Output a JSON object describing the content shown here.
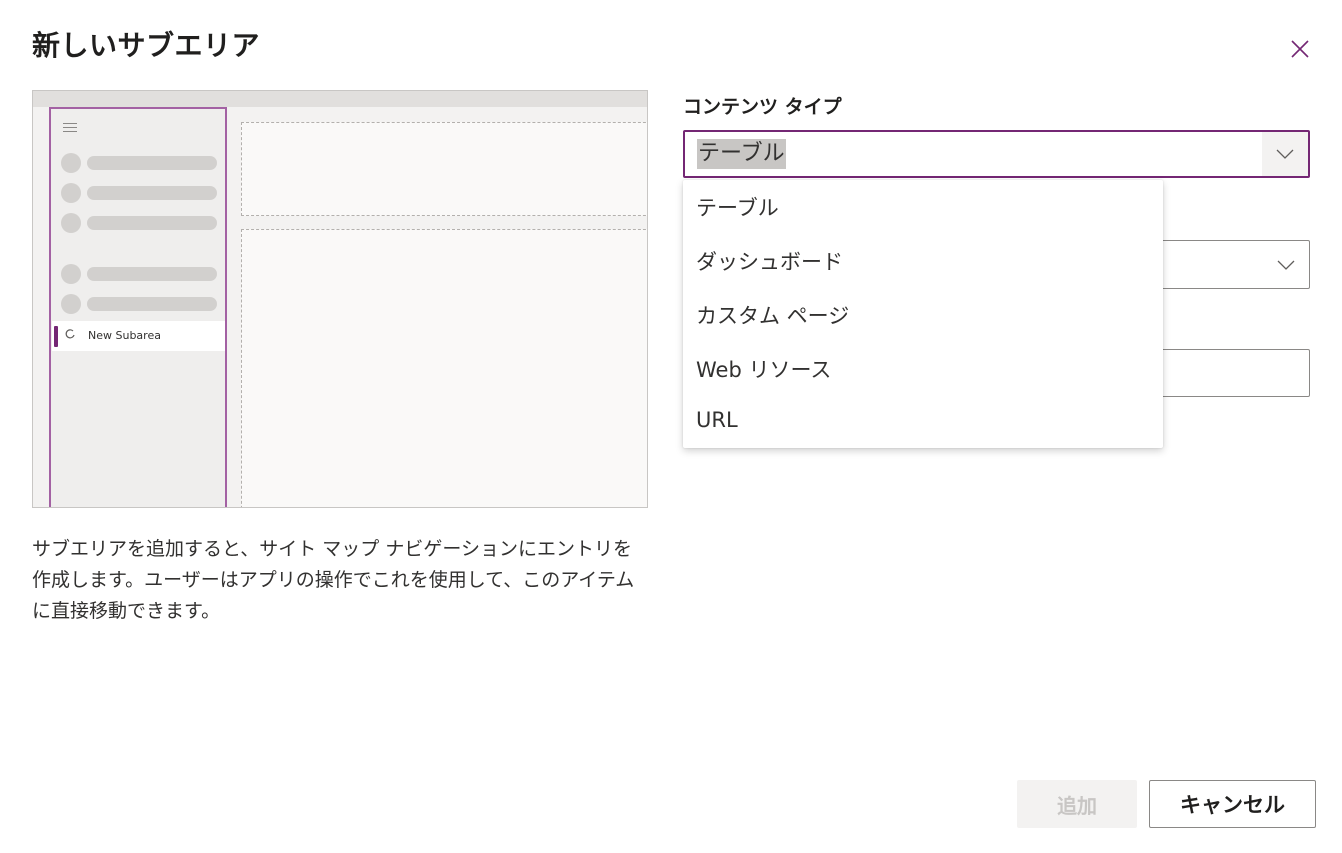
{
  "dialog": {
    "title": "新しいサブエリア",
    "close_icon": "close-icon",
    "description": "サブエリアを追加すると、サイト マップ ナビゲーションにエントリを作成します。ユーザーはアプリの操作でこれを使用して、このアイテムに直接移動できます。"
  },
  "preview": {
    "selected_item_label": "New Subarea",
    "accent_color": "#742774"
  },
  "content_type": {
    "label": "コンテンツ タイプ",
    "selected_value": "テーブル",
    "options": [
      "テーブル",
      "ダッシュボード",
      "カスタム ページ",
      "Web リソース",
      "URL"
    ]
  },
  "footer": {
    "add_label": "追加",
    "cancel_label": "キャンセル"
  }
}
